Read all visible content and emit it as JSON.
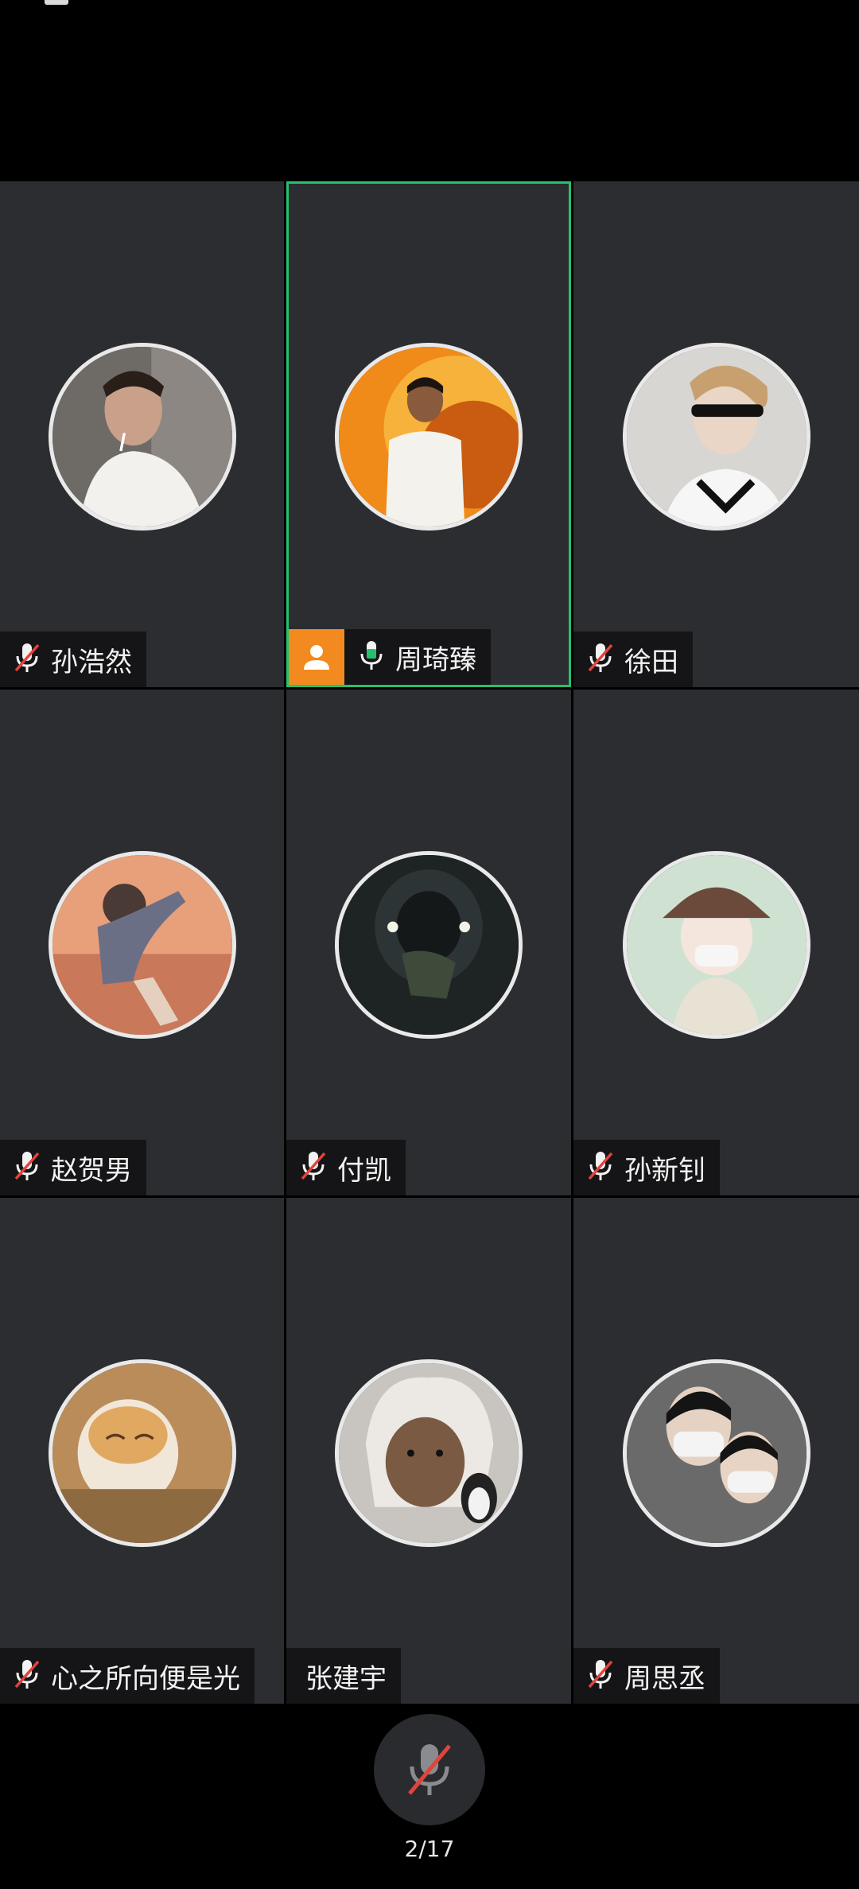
{
  "participants": [
    {
      "name": "孙浩然",
      "mic": "muted"
    },
    {
      "name": "周琦臻",
      "mic": "on",
      "host": true,
      "speaking": true
    },
    {
      "name": "徐田",
      "mic": "muted"
    },
    {
      "name": "赵贺男",
      "mic": "muted"
    },
    {
      "name": "付凯",
      "mic": "muted"
    },
    {
      "name": "孙新钊",
      "mic": "muted"
    },
    {
      "name": "心之所向便是光",
      "mic": "muted"
    },
    {
      "name": "张建宇",
      "mic": "none"
    },
    {
      "name": "周思丞",
      "mic": "muted"
    }
  ],
  "bottom": {
    "page_indicator": "2/17",
    "mute_icon": "mic-muted-icon"
  },
  "colors": {
    "tile_bg": "#2b2d30",
    "speaking_border": "#25c16f",
    "host_badge": "#f28a1f",
    "muted_slash": "#e0443d",
    "mic_on": "#25c16f"
  }
}
